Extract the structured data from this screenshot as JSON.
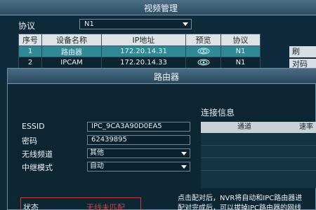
{
  "main_window": {
    "title": "视频管理",
    "protocol_label": "协议",
    "protocol_value": "N1",
    "columns": [
      "序号",
      "设备名称",
      "IP地址",
      "预览",
      "协议"
    ],
    "rows": [
      {
        "index": "1",
        "name": "路由器",
        "ip": "172.20.14.31",
        "protocol": "N1",
        "selected": true
      },
      {
        "index": "2",
        "name": "IPCAM",
        "ip": "172.20.14.33",
        "protocol": "N1",
        "selected": false
      }
    ],
    "side_buttons": [
      "刷",
      "对码"
    ]
  },
  "dialog": {
    "title": "路由器",
    "essid_label": "ESSID",
    "essid_value": "IPC_9CA3A90D0EA5",
    "password_label": "密码",
    "password_value": "62439895",
    "channel_label": "无线频道",
    "channel_value": "其他",
    "relay_label": "中继模式",
    "relay_value": "自动",
    "connection_title": "连接信息",
    "connection_columns": [
      "通道",
      "速率"
    ],
    "status_label": "状态",
    "status_value": "无线未匹配",
    "note_line1": "点击配对后，NVR将自动和IPC路由器进",
    "note_line2": "配对完成后，可以拔掉IPC路由器的网线"
  },
  "colors": {
    "accent_selected_row": "#2f8a96",
    "status_error": "#e23b3b",
    "status_box_border": "#d03a3a"
  }
}
